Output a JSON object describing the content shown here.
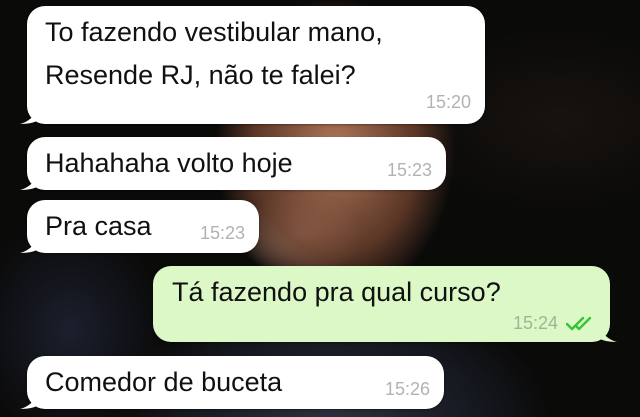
{
  "colors": {
    "incoming_bubble": "#ffffff",
    "outgoing_bubble": "#dcf8c6",
    "read_ticks": "#35c436"
  },
  "messages": [
    {
      "direction": "incoming",
      "line1": "To fazendo vestibular mano,",
      "line2": "Resende RJ, não te falei?",
      "time": "15:20"
    },
    {
      "direction": "incoming",
      "text": "Hahahaha volto hoje",
      "time": "15:23"
    },
    {
      "direction": "incoming",
      "text": "Pra casa",
      "time": "15:23"
    },
    {
      "direction": "outgoing",
      "text": "Tá fazendo pra qual curso?",
      "time": "15:24",
      "status_icon": "double-check-read-icon"
    },
    {
      "direction": "incoming",
      "text": "Comedor de buceta",
      "time": "15:26"
    }
  ]
}
